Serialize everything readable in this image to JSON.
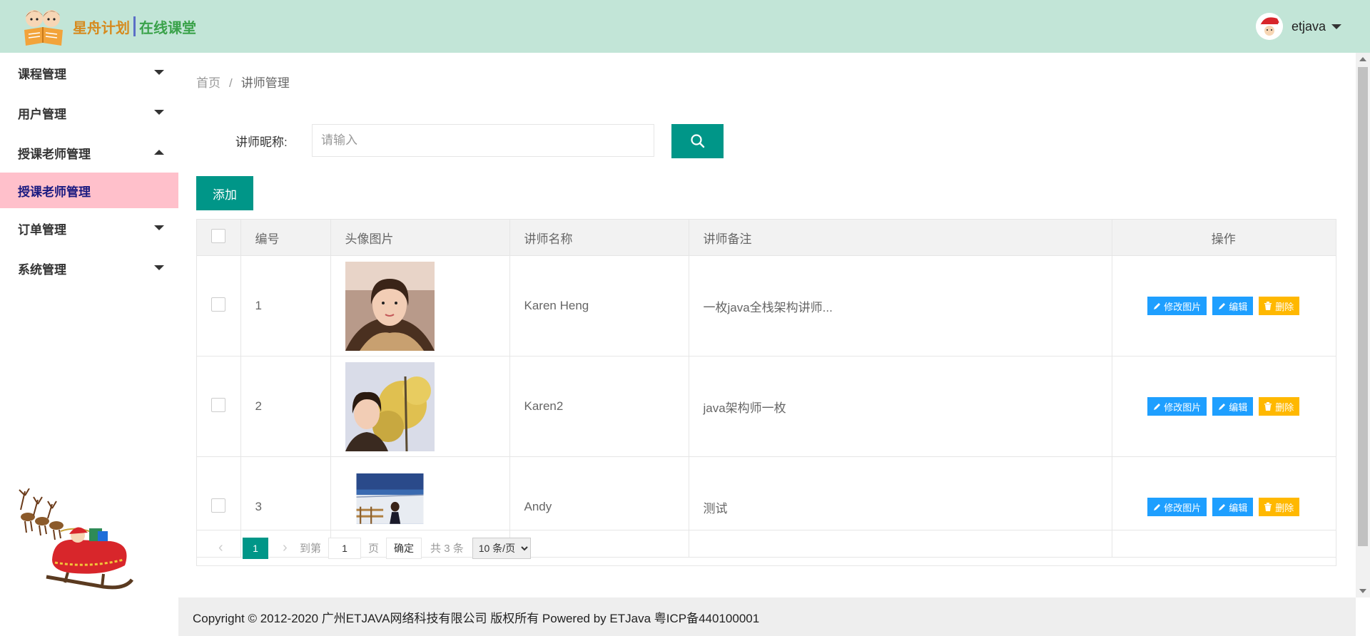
{
  "header": {
    "logo_text_a": "星舟计划",
    "logo_text_b": "在线课堂",
    "username": "etjava"
  },
  "sidebar": {
    "items": [
      {
        "label": "课程管理",
        "expanded": false
      },
      {
        "label": "用户管理",
        "expanded": false
      },
      {
        "label": "授课老师管理",
        "expanded": true,
        "sub": [
          "授课老师管理"
        ]
      },
      {
        "label": "订单管理",
        "expanded": false
      },
      {
        "label": "系统管理",
        "expanded": false
      }
    ]
  },
  "breadcrumb": {
    "home": "首页",
    "separator": "/",
    "current": "讲师管理"
  },
  "search": {
    "label": "讲师昵称:",
    "placeholder": "请输入",
    "value": ""
  },
  "toolbar": {
    "add_label": "添加"
  },
  "table": {
    "columns": [
      "",
      "编号",
      "头像图片",
      "讲师名称",
      "讲师备注",
      "操作"
    ],
    "rows": [
      {
        "id": "1",
        "name": "Karen Heng",
        "remark": "一枚java全栈架构讲师..."
      },
      {
        "id": "2",
        "name": "Karen2",
        "remark": "java架构师一枚"
      },
      {
        "id": "3",
        "name": "Andy",
        "remark": "测试"
      }
    ],
    "action_labels": {
      "change_image": "修改图片",
      "edit": "编辑",
      "delete": "删除"
    }
  },
  "pager": {
    "current_page": "1",
    "goto_label": "到第",
    "page_input": "1",
    "page_suffix": "页",
    "confirm": "确定",
    "total": "共 3 条",
    "page_size": "10 条/页"
  },
  "footer": {
    "text": "Copyright © 2012-2020 广州ETJAVA网络科技有限公司 版权所有 Powered by ETJava 粤ICP备440100001"
  },
  "colors": {
    "primary": "#009688",
    "header_bg": "#c2e5d7",
    "active_nav": "#ffc0cb",
    "blue": "#1e9fff",
    "yellow": "#ffb800"
  }
}
